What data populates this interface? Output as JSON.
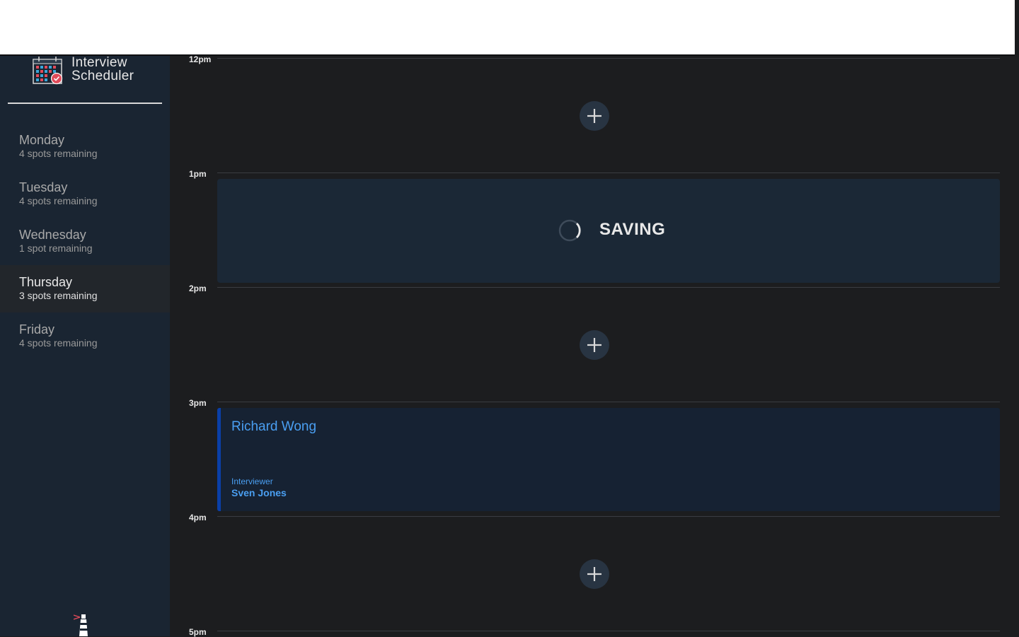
{
  "app": {
    "title_line1": "Interview",
    "title_line2": "Scheduler"
  },
  "days": [
    {
      "name": "Monday",
      "spots": "4 spots remaining",
      "selected": false
    },
    {
      "name": "Tuesday",
      "spots": "4 spots remaining",
      "selected": false
    },
    {
      "name": "Wednesday",
      "spots": "1 spot remaining",
      "selected": false
    },
    {
      "name": "Thursday",
      "spots": "3 spots remaining",
      "selected": true
    },
    {
      "name": "Friday",
      "spots": "4 spots remaining",
      "selected": false
    }
  ],
  "schedule": {
    "times": [
      "12pm",
      "1pm",
      "2pm",
      "3pm",
      "4pm",
      "5pm"
    ],
    "saving": {
      "status": "SAVING"
    },
    "appointment": {
      "student": "Richard Wong",
      "interviewer_label": "Interviewer",
      "interviewer": "Sven Jones"
    }
  },
  "icons": {
    "add": "plus-icon",
    "spinner": "spinner-icon",
    "logo": "calendar-icon",
    "footer_logo": "lighthouse-icon"
  },
  "colors": {
    "sidebar_bg": "#1a2532",
    "main_bg": "#1c1d1f",
    "selected_day_bg": "#22262b",
    "accent_blue": "#4a9ff2",
    "appointment_border": "#0a3fa7",
    "add_button_bg": "#283442"
  }
}
